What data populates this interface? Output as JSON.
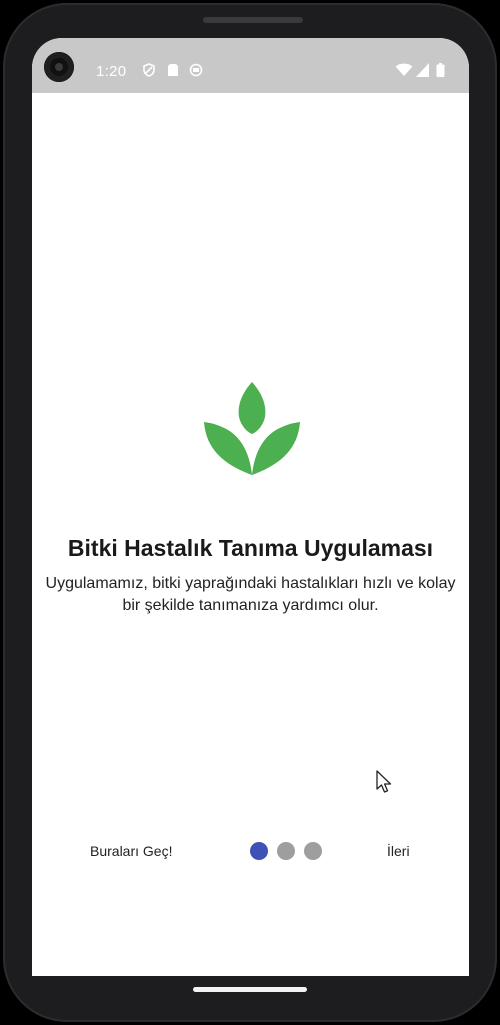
{
  "status_bar": {
    "time": "1:20",
    "left_icons": [
      "shield-icon",
      "sim-card-icon",
      "notification-icon"
    ],
    "right_icons": [
      "wifi-icon",
      "signal-icon",
      "battery-icon"
    ],
    "background_color": "#c8c8c8"
  },
  "onboarding": {
    "logo_icon": "leaf-sprout-icon",
    "logo_color": "#4caf50",
    "title": "Bitki Hastalık Tanıma Uygulaması",
    "description": "Uygulamamız, bitki yaprağındaki hastalıkları hızlı ve kolay bir şekilde tanımanıza yardımcı olur.",
    "skip_label": "Buraları Geç!",
    "next_label": "İleri",
    "page_indicator": {
      "total_pages": 3,
      "active_page": 1,
      "active_color": "#3f51b5",
      "inactive_color": "#9e9e9e"
    }
  }
}
